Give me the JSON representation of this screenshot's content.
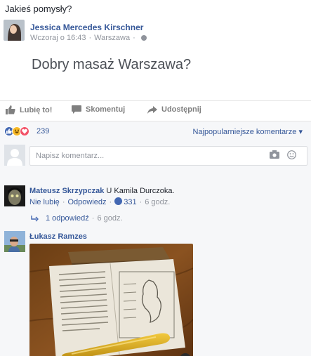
{
  "caption": "Jakieś pomysły?",
  "post": {
    "author": "Jessica Mercedes Kirschner",
    "time": "Wczoraj o 16:43",
    "location": "Warszawa",
    "text": "Dobry masaż Warszawa?"
  },
  "actions": {
    "like": "Lubię to!",
    "comment": "Skomentuj",
    "share": "Udostępnij"
  },
  "reactions": {
    "count": "239",
    "sort_label": "Najpopularniejsze komentarze",
    "icons": [
      "like-icon",
      "haha-icon",
      "love-icon"
    ]
  },
  "comment_box": {
    "placeholder": "Napisz komentarz..."
  },
  "comments": [
    {
      "author": "Mateusz Skrzypczak",
      "text": "U Kamila Durczoka.",
      "unlike": "Nie lubię",
      "reply": "Odpowiedz",
      "likes": "331",
      "time": "6 godz.",
      "replies": "1 odpowiedź",
      "replies_time": "6 godz."
    },
    {
      "author": "Łukasz Ramzes"
    }
  ],
  "colors": {
    "link": "#365899",
    "like_blue": "#4267b2",
    "love_red": "#f25268",
    "haha_yellow": "#f7b928",
    "muted": "#90949c",
    "panel": "#f6f7f9"
  }
}
